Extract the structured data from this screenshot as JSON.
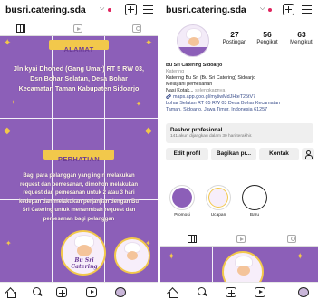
{
  "left": {
    "username": "busri.catering.sda",
    "alamat": {
      "title": "ALAMAT",
      "lines": [
        "Jln kyai Dhohed (Gang Umar) RT 5 RW 03,",
        "Dsn Bohar Selatan, Desa Bohar",
        "Kecamatan Taman Kabupaten Sidoarjo"
      ]
    },
    "perhatian": {
      "title": "PERHATIAN",
      "lines": [
        "Bagi para pelanggan yang ingin melakukan",
        "request dan pemesanan, dimohon  melakukan",
        "request dan pemesanan untuk 2 atau 3 hari",
        "kedepan dan melakukan perjanjian dengan Bu",
        "Sri Catering untuk menanmbah request dan",
        "pemesanan bagi pelanggan"
      ]
    },
    "logo_text": "Bu Sri Catering"
  },
  "right": {
    "username": "busri.catering.sda",
    "stats": [
      {
        "value": "27",
        "label": "Postingan"
      },
      {
        "value": "56",
        "label": "Pengikut"
      },
      {
        "value": "63",
        "label": "Mengikuti"
      }
    ],
    "bio": {
      "name": "Bu Sri Catering Sidoarjo",
      "category": "Katering",
      "line1": "Katering Bu Sri (Bu Sri Catering) Sidoarjo",
      "line2": "Melayani pemesanan",
      "line3_start": "Nasi Kotak...",
      "line3_more": "selengkapnya",
      "link": "maps.app.goo.gl/mytiwMdJHteT25tV7",
      "address1": "bohar Selatan RT 05 RW 03 Desa Bohar Kecamatan",
      "address2": "Taman, Sidoarjo, Jawa Timur, Indonesia 61257"
    },
    "dashboard": {
      "title": "Dasbor profesional",
      "subtitle": "141 akun dijangkau dalam 30 hari terakhir."
    },
    "buttons": {
      "edit": "Edit profil",
      "share": "Bagikan pr...",
      "contact": "Kontak"
    },
    "highlights": [
      {
        "label": "Promosi"
      },
      {
        "label": "Ucapan"
      },
      {
        "label": "Baru"
      }
    ]
  },
  "icons": {
    "top": [
      "chevron-down-icon",
      "notification-dot",
      "new-post-icon",
      "menu-icon"
    ],
    "tabs": [
      "grid-icon",
      "reels-icon",
      "tagged-icon"
    ],
    "nav": [
      "home-icon",
      "search-icon",
      "create-icon",
      "reels-icon",
      "profile-avatar-icon"
    ]
  },
  "colors": {
    "brand_purple": "#8c5fb8",
    "gold": "#f2c84b",
    "notification": "#e0245e",
    "link": "#3b4f8c"
  }
}
